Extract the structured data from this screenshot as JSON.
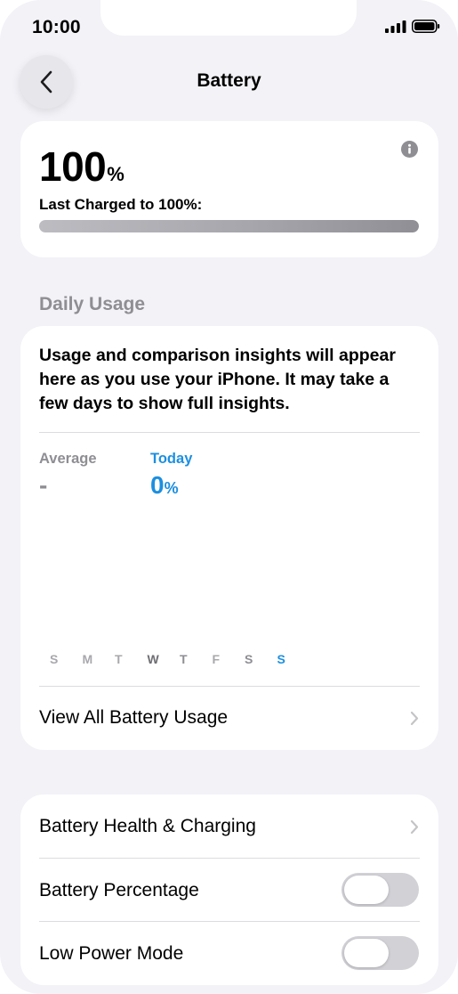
{
  "status_bar": {
    "time": "10:00"
  },
  "nav": {
    "title": "Battery"
  },
  "battery_level": {
    "value": "100",
    "unit": "%",
    "last_charged_label": "Last Charged to 100%:",
    "charge_fraction": 1.0
  },
  "daily_usage": {
    "header": "Daily Usage",
    "message": "Usage and comparison insights will appear here as you use your iPhone. It may take a few days to show full insights.",
    "average_label": "Average",
    "average_value": "-",
    "today_label": "Today",
    "today_value": "0",
    "today_unit": "%",
    "days": [
      "S",
      "M",
      "T",
      "W",
      "T",
      "F",
      "S",
      "S"
    ],
    "view_all_label": "View All Battery Usage"
  },
  "settings": {
    "health_label": "Battery Health & Charging",
    "percentage_label": "Battery Percentage",
    "percentage_on": false,
    "low_power_label": "Low Power Mode",
    "low_power_on": false
  },
  "colors": {
    "accent": "#0a84ff",
    "today_blue": "#1c8fe0",
    "secondary_text": "#8e8e93",
    "background": "#f2f2f7"
  }
}
